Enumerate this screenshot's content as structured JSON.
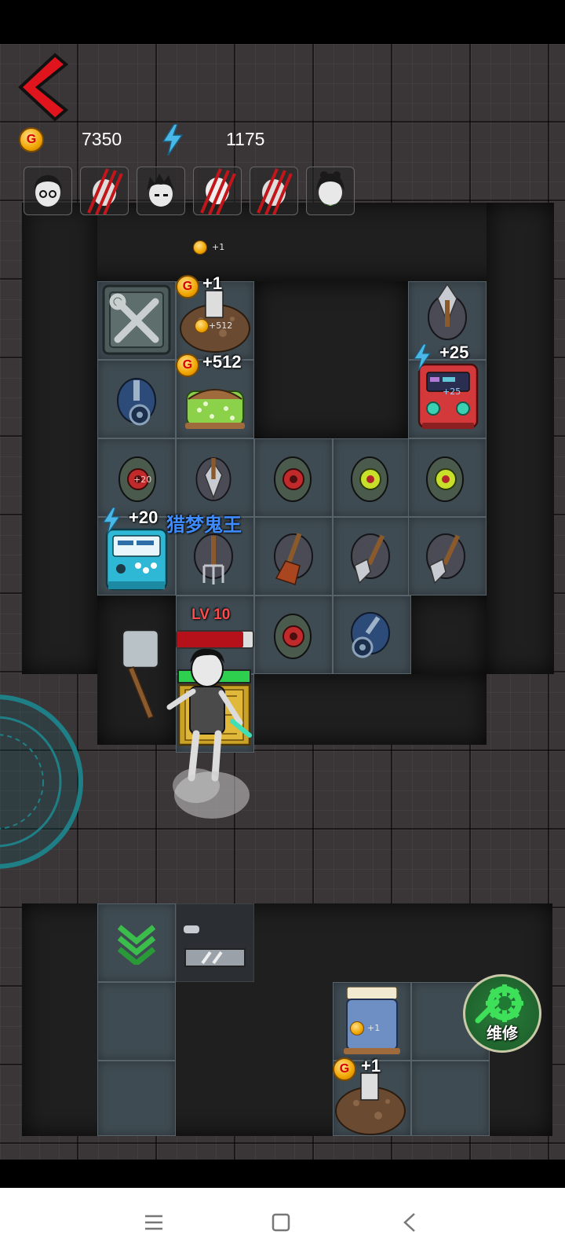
{
  "hud": {
    "coins": "7350",
    "energy": "1175",
    "coin_glyph": "G"
  },
  "portraits": [
    {
      "name": "girl-glasses-avatar",
      "clawed": false
    },
    {
      "name": "clawed-slot-1",
      "clawed": true
    },
    {
      "name": "boy-messy-hair-avatar",
      "clawed": false
    },
    {
      "name": "clawed-slot-2",
      "clawed": true
    },
    {
      "name": "clawed-slot-3",
      "clawed": true
    },
    {
      "name": "girl-green-aura-avatar",
      "clawed": false
    }
  ],
  "floaters": {
    "top_coin_plus": "+1",
    "bed_top_plus": "+1",
    "bed_top_small": "+512",
    "bed_mid_plus": "+512",
    "machine_right_plus": "+25",
    "machine_right_small": "+25",
    "machine_left_plus": "+20",
    "helmet_small": "+20",
    "bottom_bed_small": "+1",
    "bottom_dirt_plus": "+1"
  },
  "ghost_name": "猎梦鬼王",
  "ghost_level": "LV 10",
  "repair_label": "维修",
  "colors": {
    "back_arrow": "#e0141d",
    "energy": "#49b8e8",
    "ghost_name": "#3f8cff",
    "level_text": "#ff4b4b",
    "repair_green": "#1f7a34"
  }
}
